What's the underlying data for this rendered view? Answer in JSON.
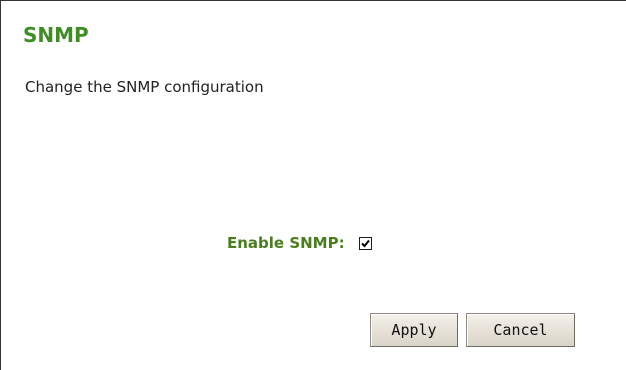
{
  "page": {
    "title": "SNMP",
    "description": "Change the SNMP configuration"
  },
  "form": {
    "enable_snmp_label": "Enable SNMP:",
    "enable_snmp_checked": true
  },
  "buttons": {
    "apply_label": "Apply",
    "cancel_label": "Cancel"
  },
  "colors": {
    "title": "#3f8d25",
    "label": "#4a7d1e"
  }
}
